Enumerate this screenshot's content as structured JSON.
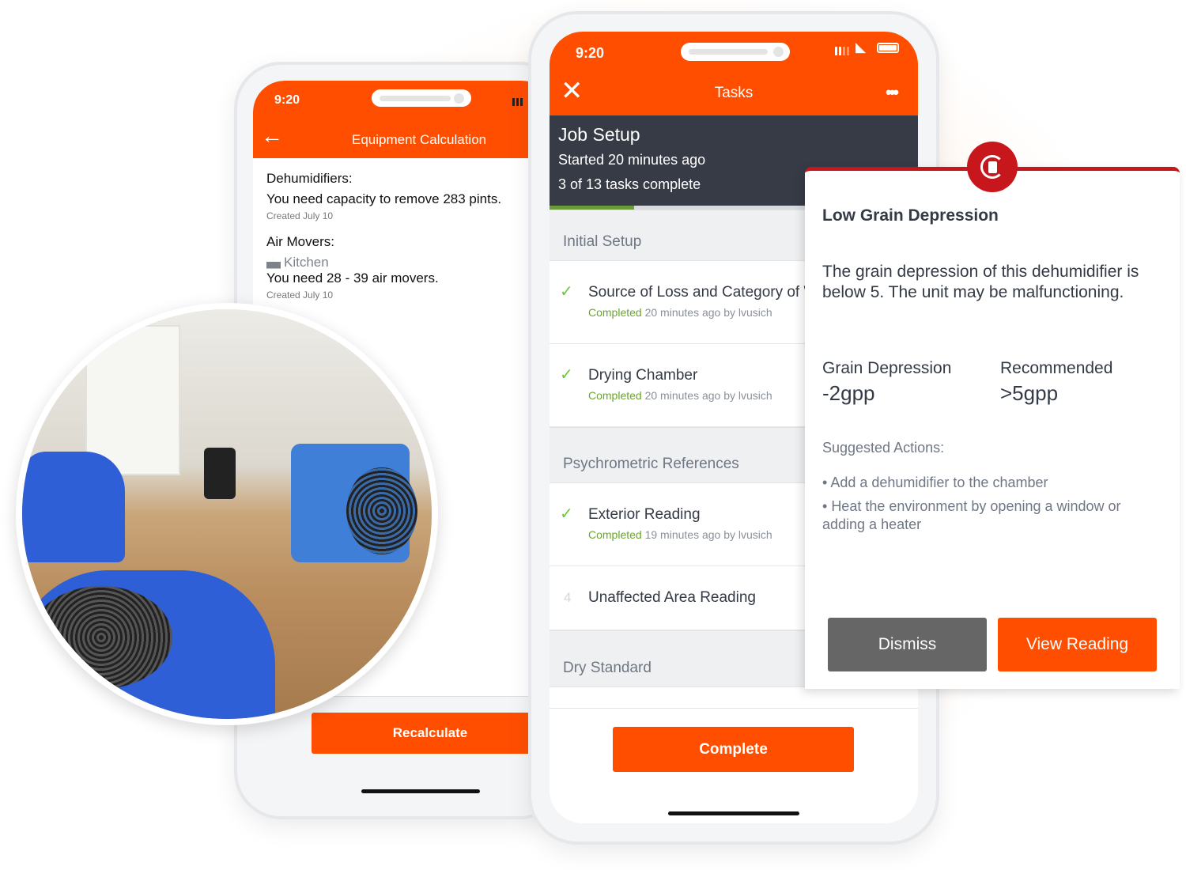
{
  "colors": {
    "brand": "#ff4e00",
    "dark": "#363b46",
    "alert": "#c8161d",
    "success": "#6cc644",
    "dismiss": "#666666"
  },
  "left_phone": {
    "time": "9:20",
    "title": "Equipment Calculation",
    "back_icon": "arrow-left-icon",
    "dehumidifiers": {
      "label": "Dehumidifiers:",
      "text": "You need capacity to remove 283 pints.",
      "created": "Created July 10"
    },
    "air_movers": {
      "label": "Air Movers:",
      "room": "Kitchen",
      "text": "You need 28 - 39 air movers.",
      "created": "Created July 10"
    },
    "recalculate_label": "Recalculate"
  },
  "middle_phone": {
    "time": "9:20",
    "title": "Tasks",
    "close_icon": "close-icon",
    "more_icon": "more-icon",
    "job": {
      "title": "Job Setup",
      "started": "Started 20 minutes ago",
      "progress_text": "3 of 13 tasks complete",
      "progress": 0.23
    },
    "sections": [
      {
        "label": "Initial Setup"
      },
      {
        "label": "Psychrometric References"
      },
      {
        "label": "Dry Standard"
      }
    ],
    "tasks": [
      {
        "title": "Source of Loss and Category of Water",
        "status": "Completed",
        "detail": "20 minutes ago by lvusich"
      },
      {
        "title": "Drying Chamber",
        "status": "Completed",
        "detail": "20 minutes ago by lvusich"
      },
      {
        "title": "Exterior Reading",
        "status": "Completed",
        "detail": "19 minutes ago by lvusich"
      },
      {
        "number": "4",
        "title": "Unaffected Area Reading"
      }
    ],
    "complete_label": "Complete"
  },
  "alert": {
    "icon": "dehumidifier-refresh-icon",
    "title": "Low Grain Depression",
    "message": "The grain depression of this dehumidifier is below 5. The unit may be malfunctioning.",
    "grain_label": "Grain Depression",
    "grain_value": "-2gpp",
    "recommended_label": "Recommended",
    "recommended_value": ">5gpp",
    "suggested_label": "Suggested Actions:",
    "actions": [
      "Add a dehumidifier to the chamber",
      "Heat the environment by opening a window or adding a heater"
    ],
    "dismiss_label": "Dismiss",
    "view_label": "View Reading"
  }
}
